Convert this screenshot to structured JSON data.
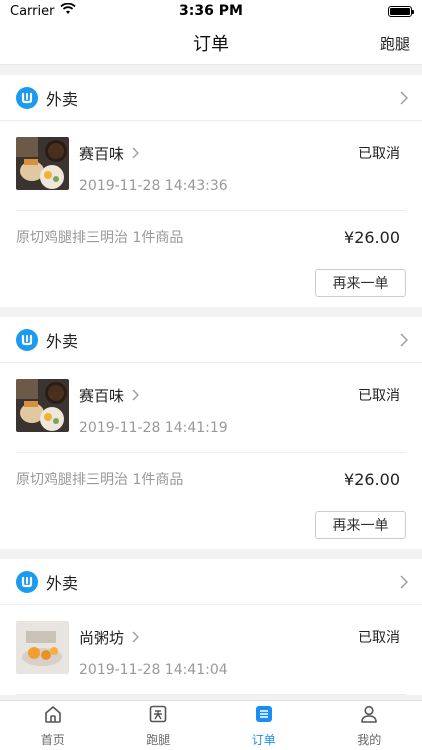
{
  "status_bar": {
    "carrier": "Carrier",
    "time": "3:36 PM"
  },
  "nav": {
    "title": "订单",
    "right_action": "跑腿"
  },
  "orders": [
    {
      "type_label": "外卖",
      "shop_name": "赛百味",
      "time": "2019-11-28 14:43:36",
      "status": "已取消",
      "goods": "原切鸡腿排三明治 1件商品",
      "price": "¥26.00",
      "reorder_label": "再来一单"
    },
    {
      "type_label": "外卖",
      "shop_name": "赛百味",
      "time": "2019-11-28 14:41:19",
      "status": "已取消",
      "goods": "原切鸡腿排三明治 1件商品",
      "price": "¥26.00",
      "reorder_label": "再来一单"
    },
    {
      "type_label": "外卖",
      "shop_name": "尚粥坊",
      "time": "2019-11-28 14:41:04",
      "status": "已取消",
      "goods": "",
      "price": "",
      "reorder_label": ""
    }
  ],
  "tabs": [
    {
      "label": "首页",
      "icon": "home-icon",
      "active": false
    },
    {
      "label": "跑腿",
      "icon": "errand-icon",
      "active": false
    },
    {
      "label": "订单",
      "icon": "order-list-icon",
      "active": true
    },
    {
      "label": "我的",
      "icon": "user-icon",
      "active": false
    }
  ],
  "colors": {
    "accent": "#1a8ef5",
    "type_icon": "#1a9bf0"
  }
}
